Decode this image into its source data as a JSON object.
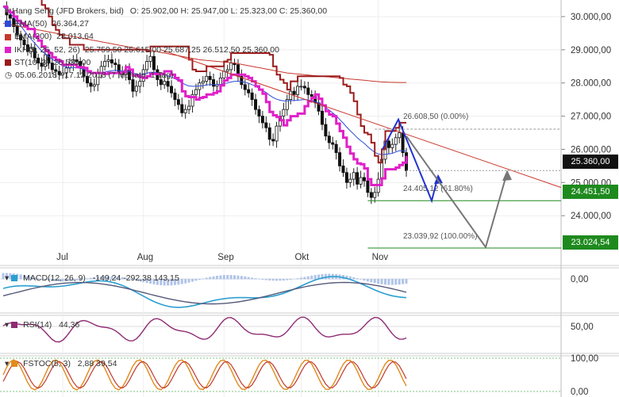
{
  "header": {
    "instrument": "Hang Seng (JFD Brokers, bid)",
    "ohlc": "O: 25.902,00  H: 25.947,00  L: 25.323,00  C: 25.360,00"
  },
  "legend": [
    {
      "label": "EMA(50)",
      "value": "26.364,27",
      "color": "#2b4bd8"
    },
    {
      "label": "EMA(200)",
      "value": "28.013,64",
      "color": "#c8372d"
    },
    {
      "label": "IKH(9, 26, 52, 26)",
      "value": "25.759,50  25.615,00  25.687,25  26.512,50  25.360,00",
      "color": "#e020c8"
    },
    {
      "label": "ST(10, 3)",
      "value": "26.535,00",
      "color": "#9b1c1c"
    }
  ],
  "period": "05.06.2018 - 17.12.2018 (7 Monate, 1 Tag)",
  "price_tags": [
    {
      "value": "25.360,00",
      "bg": "#111111"
    },
    {
      "value": "24.451,50",
      "bg": "#1e8a1e"
    },
    {
      "value": "23.024,54",
      "bg": "#1e8a1e"
    }
  ],
  "fib_labels": [
    "26.608,50 (0.00%)",
    "24.405,12 (61.80%)",
    "23.039,92 (100.00%)"
  ],
  "indicators": {
    "macd": {
      "label": "MACD(12, 26, 9)",
      "values": "-149,24  -292,38  143,15",
      "ticks": [
        "0,00"
      ]
    },
    "rsi": {
      "label": "RSI(14)",
      "values": "44,36",
      "ticks": [
        "50,00"
      ]
    },
    "fstoc": {
      "label": "FSTOC(5, 3)",
      "values": "2,88  39,54",
      "ticks": [
        "100,00",
        "0,00"
      ]
    }
  },
  "chart_data": {
    "type": "line",
    "title": "Hang Seng (JFD Brokers, bid)",
    "ylim": [
      22500,
      30500
    ],
    "yticks": [
      "30.000,00",
      "29.000,00",
      "28.000,00",
      "27.000,00",
      "26.000,00",
      "25.000,00",
      "24.000,00"
    ],
    "ytick_values": [
      30000,
      29000,
      28000,
      27000,
      26000,
      25000,
      24000
    ],
    "xticks": [
      "Jul",
      "Aug",
      "Sep",
      "Okt",
      "Nov"
    ],
    "xtick_index": [
      17,
      40,
      63,
      85,
      107
    ],
    "candles_close": [
      30300,
      30050,
      29950,
      29700,
      29450,
      29300,
      29150,
      28950,
      29050,
      28750,
      28600,
      28500,
      28850,
      28600,
      28400,
      28350,
      28250,
      28300,
      28450,
      28550,
      28700,
      28650,
      28450,
      28200,
      28000,
      27900,
      27950,
      28300,
      28500,
      28650,
      28700,
      28600,
      28550,
      28300,
      28250,
      28400,
      28100,
      27750,
      27900,
      28050,
      28400,
      28650,
      28800,
      28400,
      28100,
      27950,
      28050,
      27900,
      27700,
      27500,
      27350,
      27100,
      27200,
      27300,
      27650,
      27800,
      28000,
      28050,
      28200,
      28100,
      27900,
      27950,
      28150,
      28350,
      28400,
      28600,
      28550,
      28200,
      27950,
      27800,
      27700,
      27500,
      27200,
      27000,
      26800,
      26650,
      26300,
      26250,
      26700,
      27000,
      27200,
      27500,
      27750,
      27650,
      27900,
      27900,
      27850,
      27650,
      27600,
      27400,
      27150,
      26750,
      26400,
      26200,
      26150,
      25900,
      25500,
      25300,
      25000,
      25100,
      25300,
      24950,
      25150,
      25050,
      24700,
      24550,
      24700,
      25100,
      25700,
      26250,
      26050,
      26150,
      26350,
      26500,
      25900,
      25360
    ],
    "ema50": [
      30300,
      30200,
      30100,
      29980,
      29850,
      29720,
      29580,
      29440,
      29320,
      29200,
      29080,
      28960,
      28880,
      28800,
      28720,
      28650,
      28580,
      28520,
      28480,
      28460,
      28460,
      28460,
      28440,
      28410,
      28370,
      28320,
      28280,
      28280,
      28300,
      28330,
      28350,
      28370,
      28380,
      28370,
      28360,
      28360,
      28340,
      28300,
      28270,
      28250,
      28260,
      28290,
      28320,
      28320,
      28300,
      28270,
      28250,
      28220,
      28180,
      28130,
      28070,
      28000,
      27950,
      27910,
      27900,
      27900,
      27910,
      27920,
      27940,
      27950,
      27950,
      27950,
      27960,
      27980,
      28000,
      28030,
      28050,
      28050,
      28040,
      28020,
      27990,
      27950,
      27900,
      27840,
      27780,
      27710,
      27630,
      27560,
      27510,
      27480,
      27460,
      27460,
      27470,
      27470,
      27480,
      27490,
      27500,
      27490,
      27470,
      27440,
      27400,
      27340,
      27260,
      27180,
      27100,
      27010,
      26900,
      26790,
      26670,
      26560,
      26460,
      26350,
      26260,
      26180,
      26080,
      25990,
      25910,
      25860,
      25840,
      25850,
      25860,
      25880,
      25920,
      25960,
      25960,
      25940
    ],
    "ema200": [
      29800,
      29780,
      29760,
      29740,
      29720,
      29700,
      29680,
      29660,
      29640,
      29620,
      29600,
      29580,
      29560,
      29540,
      29520,
      29500,
      29480,
      29460,
      29440,
      29420,
      29400,
      29380,
      29360,
      29340,
      29320,
      29300,
      29280,
      29260,
      29240,
      29220,
      29200,
      29180,
      29160,
      29140,
      29120,
      29100,
      29080,
      29060,
      29040,
      29020,
      29000,
      28980,
      28970,
      28960,
      28940,
      28920,
      28900,
      28880,
      28860,
      28840,
      28820,
      28800,
      28780,
      28760,
      28740,
      28720,
      28700,
      28690,
      28680,
      28670,
      28660,
      28650,
      28640,
      28630,
      28620,
      28610,
      28600,
      28580,
      28560,
      28540,
      28520,
      28500,
      28480,
      28460,
      28440,
      28420,
      28400,
      28380,
      28360,
      28340,
      28320,
      28300,
      28290,
      28280,
      28270,
      28260,
      28250,
      28240,
      28230,
      28220,
      28210,
      28200,
      28190,
      28180,
      28170,
      28160,
      28150,
      28140,
      28130,
      28120,
      28110,
      28100,
      28090,
      28080,
      28070,
      28060,
      28050,
      28040,
      28030,
      28025,
      28020,
      28018,
      28016,
      28015,
      28014,
      28013.64
    ]
  }
}
